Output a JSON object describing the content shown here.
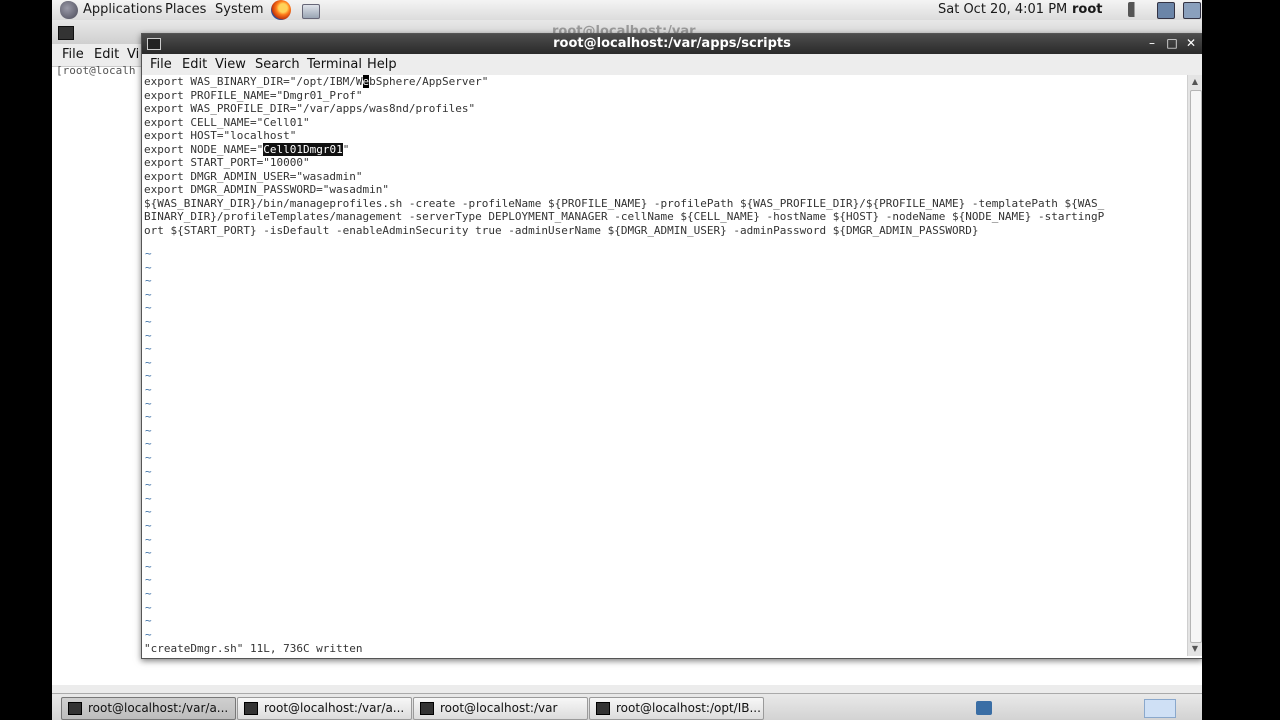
{
  "top_panel": {
    "menus": [
      "Applications",
      "Places",
      "System"
    ],
    "clock": "Sat Oct 20,  4:01 PM",
    "user": "root"
  },
  "background_window": {
    "title": "root@localhost:/var",
    "menus": [
      "File",
      "Edit",
      "Vi"
    ],
    "prompt": "[root@localh"
  },
  "terminal": {
    "title": "root@localhost:/var/apps/scripts",
    "menus": [
      "File",
      "Edit",
      "View",
      "Search",
      "Terminal",
      "Help"
    ],
    "lines": {
      "l1a": "export WAS_BINARY_DIR=\"/opt/IBM/W",
      "l1cursor": "e",
      "l1b": "bSphere/AppServer\"",
      "l2": "export PROFILE_NAME=\"Dmgr01_Prof\"",
      "l3": "export WAS_PROFILE_DIR=\"/var/apps/was8nd/profiles\"",
      "l4": "export CELL_NAME=\"Cell01\"",
      "l5": "export HOST=\"localhost\"",
      "l6a": "export NODE_NAME=\"",
      "l6sel": "Cell01Dmgr01",
      "l6b": "\"",
      "l7": "export START_PORT=\"10000\"",
      "l8": "export DMGR_ADMIN_USER=\"wasadmin\"",
      "l9": "export DMGR_ADMIN_PASSWORD=\"wasadmin\"",
      "l10": "${WAS_BINARY_DIR}/bin/manageprofiles.sh -create -profileName ${PROFILE_NAME} -profilePath ${WAS_PROFILE_DIR}/${PROFILE_NAME} -templatePath ${WAS_",
      "l11": "BINARY_DIR}/profileTemplates/management -serverType DEPLOYMENT_MANAGER -cellName ${CELL_NAME} -hostName ${HOST} -nodeName ${NODE_NAME} -startingP",
      "l12": "ort ${START_PORT} -isDefault -enableAdminSecurity true -adminUserName ${DMGR_ADMIN_USER} -adminPassword ${DMGR_ADMIN_PASSWORD}"
    },
    "empty_marker": "~",
    "status": "\"createDmgr.sh\" 11L, 736C written"
  },
  "taskbar": [
    {
      "label": "root@localhost:/var/a...",
      "active": true
    },
    {
      "label": "root@localhost:/var/a...",
      "active": false
    },
    {
      "label": "root@localhost:/var",
      "active": false
    },
    {
      "label": "root@localhost:/opt/IB...",
      "active": false
    }
  ]
}
